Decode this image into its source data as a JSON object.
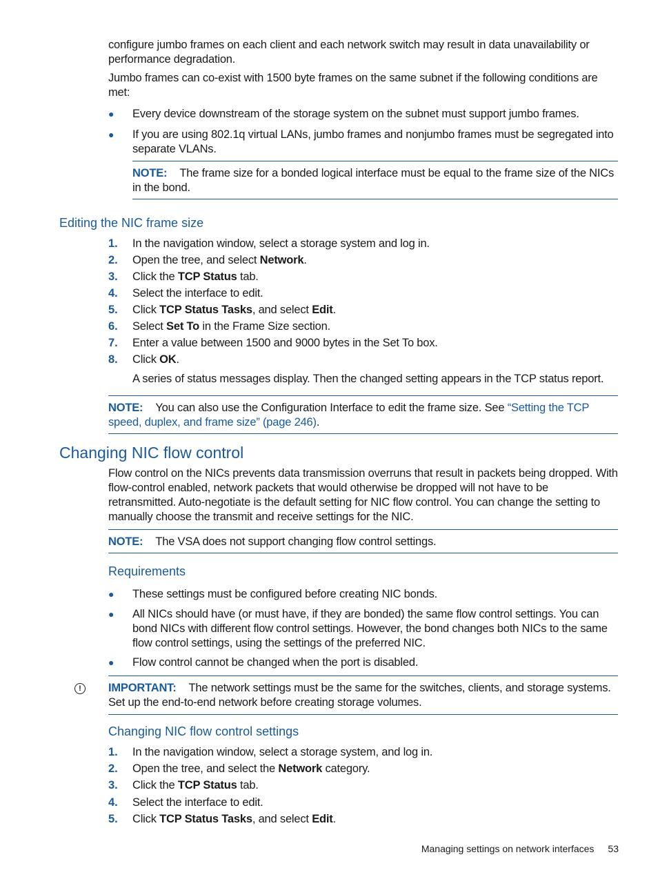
{
  "intro": {
    "para1": "configure jumbo frames on each client and each network switch may result in data unavailability or performance degradation.",
    "para2": "Jumbo frames can co-exist with 1500 byte frames on the same subnet if the following conditions are met:",
    "bullets": [
      "Every device downstream of the storage system on the subnet must support jumbo frames.",
      "If you are using 802.1q virtual LANs, jumbo frames and nonjumbo frames must be segregated into separate VLANs."
    ],
    "note": {
      "label": "NOTE:",
      "text": "The frame size for a bonded logical interface must be equal to the frame size of the NICs in the bond."
    }
  },
  "editing": {
    "heading": "Editing the NIC frame size",
    "steps": [
      {
        "num": "1.",
        "pre": "In the navigation window, select a storage system and log in.",
        "bold": "",
        "mid": "",
        "bold2": "",
        "post": ""
      },
      {
        "num": "2.",
        "pre": "Open the tree, and select ",
        "bold": "Network",
        "mid": ".",
        "bold2": "",
        "post": ""
      },
      {
        "num": "3.",
        "pre": "Click the ",
        "bold": "TCP Status",
        "mid": " tab.",
        "bold2": "",
        "post": ""
      },
      {
        "num": "4.",
        "pre": "Select the interface to edit.",
        "bold": "",
        "mid": "",
        "bold2": "",
        "post": ""
      },
      {
        "num": "5.",
        "pre": "Click ",
        "bold": "TCP Status Tasks",
        "mid": ", and select ",
        "bold2": "Edit",
        "post": "."
      },
      {
        "num": "6.",
        "pre": "Select ",
        "bold": "Set To",
        "mid": " in the Frame Size section.",
        "bold2": "",
        "post": ""
      },
      {
        "num": "7.",
        "pre": "Enter a value between 1500 and 9000 bytes in the Set To box.",
        "bold": "",
        "mid": "",
        "bold2": "",
        "post": ""
      },
      {
        "num": "8.",
        "pre": "Click ",
        "bold": "OK",
        "mid": ".",
        "bold2": "",
        "post": ""
      }
    ],
    "result": "A series of status messages display. Then the changed setting appears in the TCP status report.",
    "note": {
      "label": "NOTE:",
      "text": "You can also use the Configuration Interface to edit the frame size. See ",
      "link": "“Setting the TCP speed, duplex, and frame size” (page 246)",
      "after": "."
    }
  },
  "flow": {
    "heading": "Changing NIC flow control",
    "para": "Flow control on the NICs prevents data transmission overruns that result in packets being dropped. With flow-control enabled, network packets that would otherwise be dropped will not have to be retransmitted. Auto-negotiate is the default setting for NIC flow control. You can change the setting to manually choose the transmit and receive settings for the NIC.",
    "note": {
      "label": "NOTE:",
      "text": "The VSA does not support changing flow control settings."
    },
    "requirements": {
      "heading": "Requirements",
      "bullets": [
        "These settings must be configured before creating NIC bonds.",
        "All NICs should have (or must have, if they are bonded) the same flow control settings. You can bond NICs with different flow control settings. However, the bond changes both NICs to the same flow control settings, using the settings of the preferred NIC.",
        "Flow control cannot be changed when the port is disabled."
      ]
    },
    "important": {
      "icon": "!",
      "label": "IMPORTANT:",
      "text": "The network settings must be the same for the switches, clients, and storage systems. Set up the end-to-end network before creating storage volumes."
    },
    "settings": {
      "heading": "Changing NIC flow control settings",
      "steps": [
        {
          "num": "1.",
          "pre": "In the navigation window, select a storage system, and log in.",
          "bold": "",
          "mid": "",
          "bold2": "",
          "post": ""
        },
        {
          "num": "2.",
          "pre": "Open the tree, and select the ",
          "bold": "Network",
          "mid": " category.",
          "bold2": "",
          "post": ""
        },
        {
          "num": "3.",
          "pre": "Click the ",
          "bold": "TCP Status",
          "mid": " tab.",
          "bold2": "",
          "post": ""
        },
        {
          "num": "4.",
          "pre": "Select the interface to edit.",
          "bold": "",
          "mid": "",
          "bold2": "",
          "post": ""
        },
        {
          "num": "5.",
          "pre": "Click ",
          "bold": "TCP Status Tasks",
          "mid": ", and select ",
          "bold2": "Edit",
          "post": "."
        }
      ]
    }
  },
  "footer": {
    "section": "Managing settings on network interfaces",
    "page": "53"
  }
}
